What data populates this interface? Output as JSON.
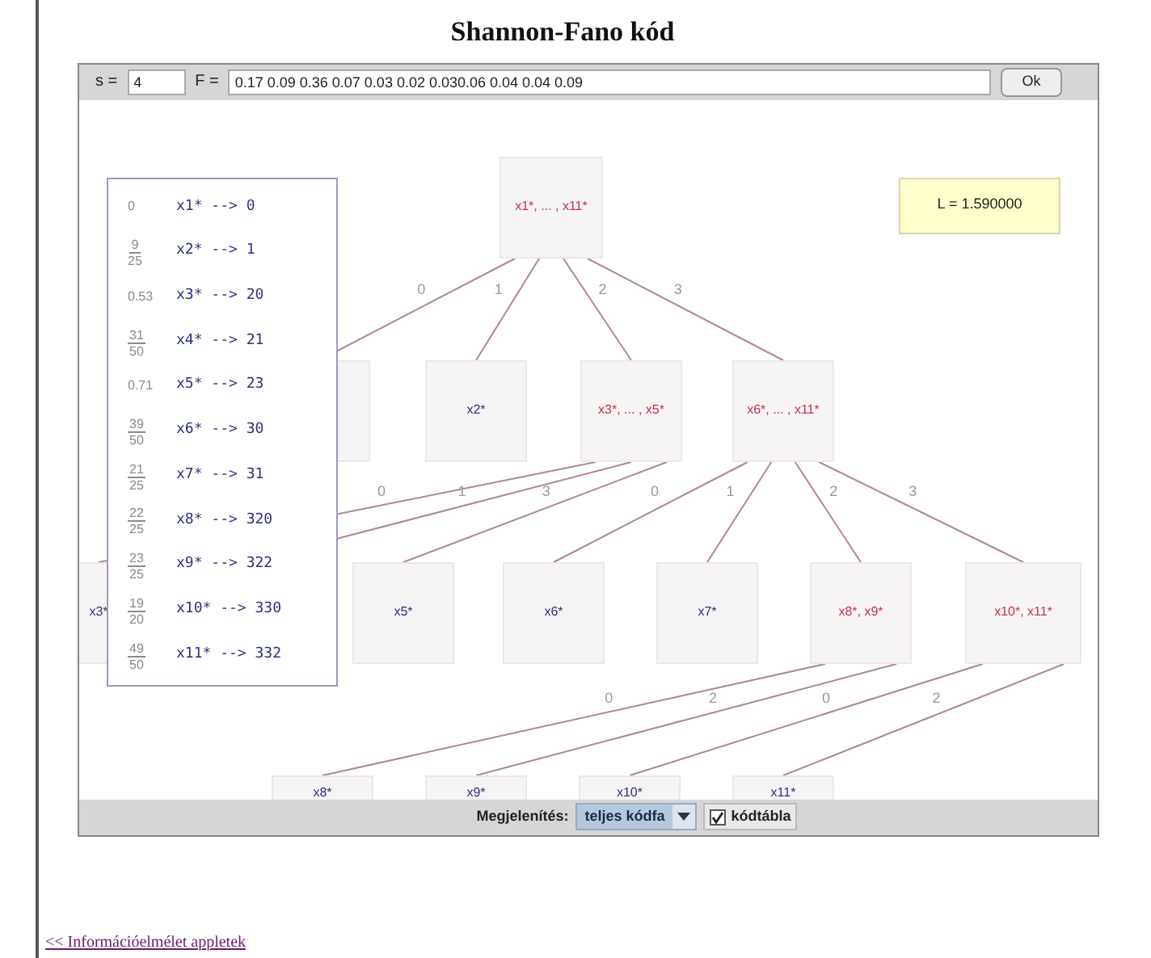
{
  "title": "Shannon-Fano kód",
  "toolbar": {
    "s_label": "s =",
    "s_value": "4",
    "f_label": "F =",
    "f_value": "0.17 0.09 0.36 0.07 0.03 0.02 0.030.06 0.04 0.04 0.09",
    "ok_button": "Ok"
  },
  "tree": {
    "label": "x1*, ... , x11*",
    "kind": "group",
    "children": [
      {
        "edge": "0"
      },
      {
        "label": "x2*",
        "kind": "leaf",
        "edge": "1"
      },
      {
        "label": "x3*, ... , x5*",
        "kind": "group",
        "edge": "2",
        "children": [
          {
            "label": "x3*",
            "kind": "leaf",
            "edge": "0"
          },
          {
            "edge": "1"
          },
          {
            "label": "x5*",
            "kind": "leaf",
            "edge": "3"
          }
        ]
      },
      {
        "label": "x6*, ... , x11*",
        "kind": "group",
        "edge": "3",
        "children": [
          {
            "label": "x6*",
            "kind": "leaf",
            "edge": "0"
          },
          {
            "label": "x7*",
            "kind": "leaf",
            "edge": "1"
          },
          {
            "label": "x8*, x9*",
            "kind": "group",
            "edge": "2",
            "children": [
              {
                "label": "x8*",
                "kind": "leaf",
                "edge": "0"
              },
              {
                "label": "x9*",
                "kind": "leaf",
                "edge": "2"
              }
            ]
          },
          {
            "label": "x10*, x11*",
            "kind": "group",
            "edge": "3",
            "children": [
              {
                "label": "x10*",
                "kind": "leaf",
                "edge": "0"
              },
              {
                "label": "x11*",
                "kind": "leaf",
                "edge": "2"
              }
            ]
          }
        ]
      }
    ]
  },
  "length_box": "L = 1.590000",
  "code_table": [
    {
      "kind": "decimal",
      "value": "0",
      "code": "x1* --> 0"
    },
    {
      "kind": "fraction",
      "numerator": "9",
      "denominator": "25",
      "code": "x2* --> 1"
    },
    {
      "kind": "decimal",
      "value": "0.53",
      "code": "x3* --> 20"
    },
    {
      "kind": "fraction",
      "numerator": "31",
      "denominator": "50",
      "code": "x4* --> 21"
    },
    {
      "kind": "decimal",
      "value": "0.71",
      "code": "x5* --> 23"
    },
    {
      "kind": "fraction",
      "numerator": "39",
      "denominator": "50",
      "code": "x6* --> 30"
    },
    {
      "kind": "fraction",
      "numerator": "21",
      "denominator": "25",
      "code": "x7* --> 31"
    },
    {
      "kind": "fraction",
      "numerator": "22",
      "denominator": "25",
      "code": "x8* --> 320"
    },
    {
      "kind": "fraction",
      "numerator": "23",
      "denominator": "25",
      "code": "x9* --> 322"
    },
    {
      "kind": "fraction",
      "numerator": "19",
      "denominator": "20",
      "code": "x10* --> 330"
    },
    {
      "kind": "fraction",
      "numerator": "49",
      "denominator": "50",
      "code": "x11* --> 332"
    }
  ],
  "display": {
    "label": "Megjelenítés:",
    "select_value": "teljes kódfa",
    "checkbox_label": "kódtábla",
    "checked": true
  },
  "back_link": "<< Információelmélet appletek"
}
